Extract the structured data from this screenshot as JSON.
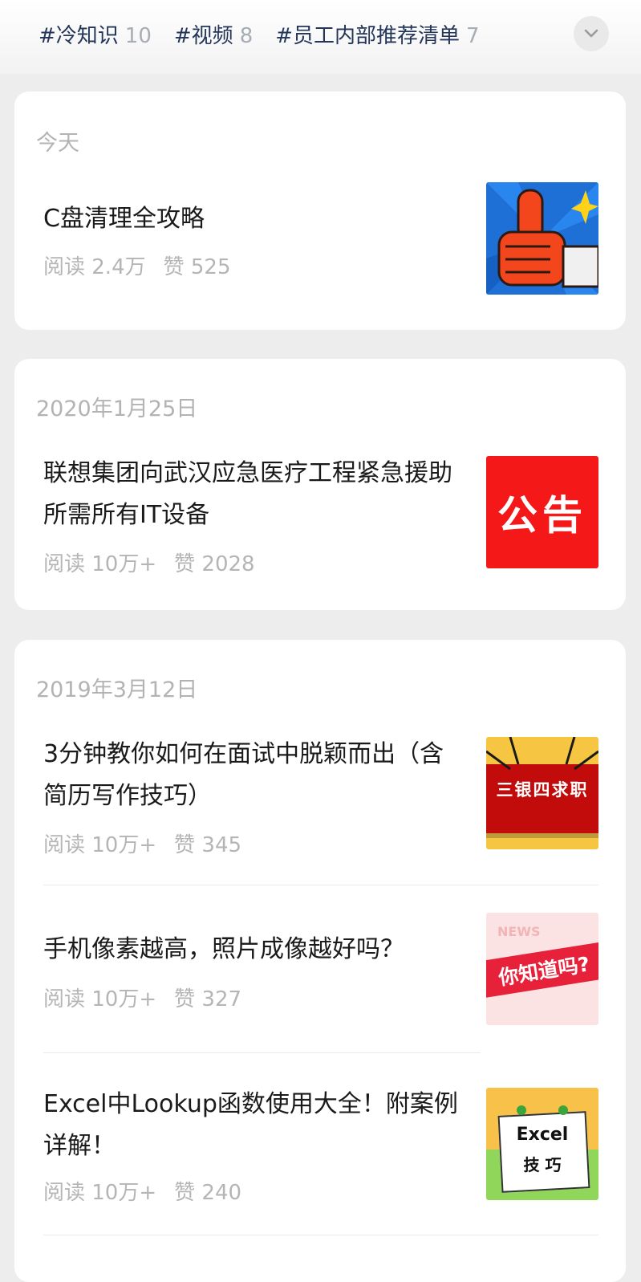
{
  "tags": [
    {
      "label": "#冷知识",
      "count": "10"
    },
    {
      "label": "#视频",
      "count": "8"
    },
    {
      "label": "#员工内部推荐清单",
      "count": "7"
    }
  ],
  "groups": [
    {
      "date": "今天",
      "articles": [
        {
          "title": "C盘清理全攻略",
          "read": "阅读 2.4万",
          "like": "赞 525"
        }
      ]
    },
    {
      "date": "2020年1月25日",
      "articles": [
        {
          "title": "联想集团向武汉应急医疗工程紧急援助所需所有IT设备",
          "read": "阅读 10万+",
          "like": "赞 2028",
          "thumb_text": "公告"
        }
      ]
    },
    {
      "date": "2019年3月12日",
      "articles": [
        {
          "title": "3分钟教你如何在面试中脱颖而出（含简历写作技巧）",
          "read": "阅读 10万+",
          "like": "赞 345",
          "thumb_text": "三银四求职"
        },
        {
          "title": "手机像素越高，照片成像越好吗？",
          "read": "阅读 10万+",
          "like": "赞 327",
          "thumb_text": "你知道吗?",
          "thumb_sub": "NEWS"
        },
        {
          "title": "Excel中Lookup函数使用大全！附案例详解！",
          "read": "阅读 10万+",
          "like": "赞 240",
          "thumb_text": "Excel",
          "thumb_sub": "技 巧"
        }
      ]
    }
  ],
  "colors": {
    "tag": "#24355a",
    "count": "#a8adb5",
    "meta": "#b5b5b5",
    "notice_red": "#f51818"
  }
}
